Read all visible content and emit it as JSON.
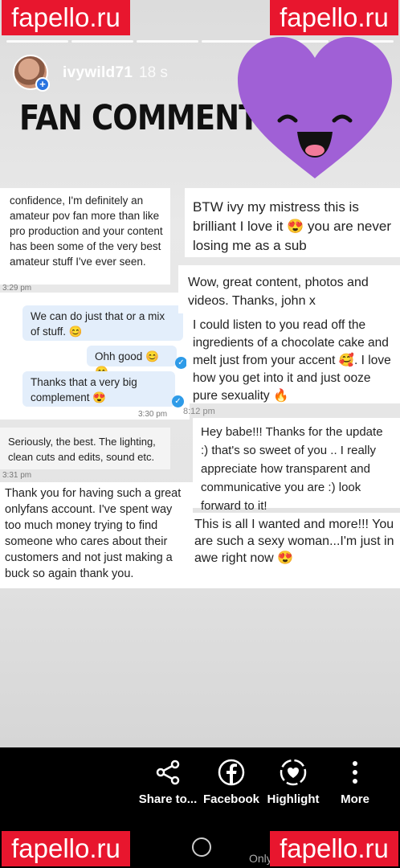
{
  "header": {
    "username": "ivywild71",
    "time_ago": "18 s",
    "progress_segments": 6
  },
  "story": {
    "title": "FAN COMMENTS"
  },
  "left": {
    "card1_text": "confidence, I'm definitely an amateur pov fan more than like pro production and your content has been some of the very best amateur stuff I've ever seen.",
    "card1_ts": "3:29 pm",
    "msg1": "We can do just that or a mix of stuff. 😊",
    "msg2": "Ohh good 😊😊",
    "msg3": "Thanks that a very big complement 😍",
    "msg3_ts": "3:30 pm",
    "card2_text": "Seriously, the best. The lighting, clean cuts and edits, sound etc.",
    "card2_ts": "3:31 pm",
    "card3_text": "Thank you for having such a great onlyfans account. I've spent way too much money trying to find someone who cares about their customers and not just making a buck so again thank you."
  },
  "right": {
    "card1_text": "BTW ivy my mistress this is brilliant I love it 😍 you are never losing me as a sub",
    "card2_text": "Wow, great content, photos and videos. Thanks, john x",
    "card3_text": "I could listen to you read off the ingredients of a chocolate cake and melt just from your accent 🥰. I love how you get into it and just ooze pure sexuality 🔥",
    "card3_ts": "8:12 pm",
    "card4_text": "Hey babe!!! Thanks for the update :) that's so sweet of you .. I really appreciate how transparent and communicative you are :) look forward to it!",
    "card5_text": "This is all I wanted and more!!! You are such a sexy woman...I'm just in awe right now 😍"
  },
  "actions": {
    "share": "Share to...",
    "facebook": "Facebook",
    "highlight": "Highlight",
    "more": "More"
  },
  "footer_text": "Only",
  "watermark": "fapello.ru",
  "colors": {
    "watermark_bg": "#e8162e",
    "heart": "#a060d6",
    "check": "#2e9be8"
  }
}
